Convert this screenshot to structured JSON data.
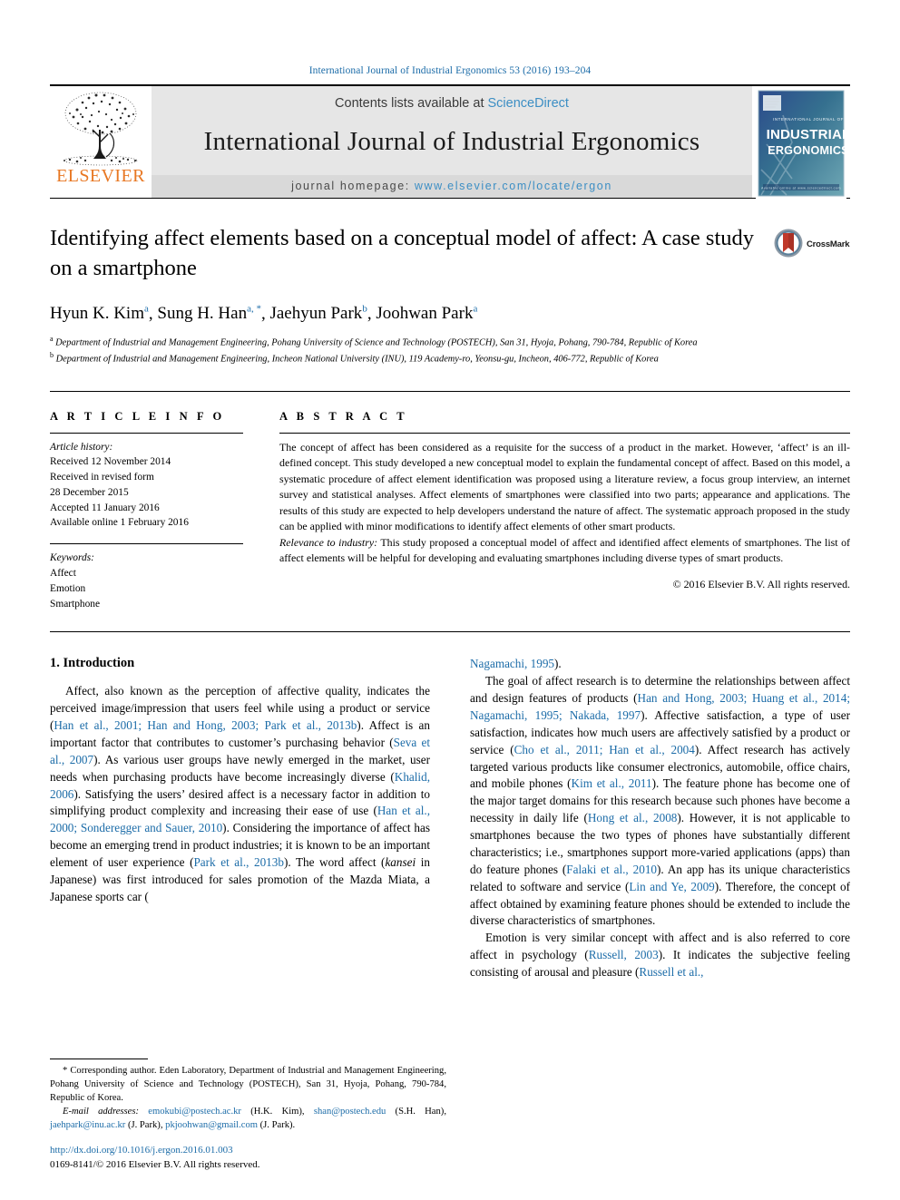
{
  "running_head": "International Journal of Industrial Ergonomics 53 (2016) 193–204",
  "masthead": {
    "contents_prefix": "Contents lists available at ",
    "sciencedirect": "ScienceDirect",
    "journal_name": "International Journal of Industrial Ergonomics",
    "homepage_label": "journal homepage: ",
    "homepage_url": "www.elsevier.com/locate/ergon",
    "publisher": "ELSEVIER",
    "cover_line1": "INTERNATIONAL JOURNAL OF",
    "cover_line2": "INDUSTRIAL",
    "cover_line3": "ERGONOMICS",
    "accent_blue": "#3c8ec4",
    "elsevier_orange": "#e87722"
  },
  "article": {
    "title": "Identifying affect elements based on a conceptual model of affect: A case study on a smartphone",
    "crossmark_label": "CrossMark",
    "authors": [
      {
        "name": "Hyun K. Kim",
        "sup": "a"
      },
      {
        "name": "Sung H. Han",
        "sup": "a, *"
      },
      {
        "name": "Jaehyun Park",
        "sup": "b"
      },
      {
        "name": "Joohwan Park",
        "sup": "a"
      }
    ],
    "affiliations": [
      {
        "mark": "a",
        "text": "Department of Industrial and Management Engineering, Pohang University of Science and Technology (POSTECH), San 31, Hyoja, Pohang, 790-784, Republic of Korea"
      },
      {
        "mark": "b",
        "text": "Department of Industrial and Management Engineering, Incheon National University (INU), 119 Academy-ro, Yeonsu-gu, Incheon, 406-772, Republic of Korea"
      }
    ]
  },
  "article_info": {
    "heading": "A R T I C L E  I N F O",
    "history_label": "Article history:",
    "history": [
      "Received 12 November 2014",
      "Received in revised form",
      "28 December 2015",
      "Accepted 11 January 2016",
      "Available online 1 February 2016"
    ],
    "keywords_label": "Keywords:",
    "keywords": [
      "Affect",
      "Emotion",
      "Smartphone"
    ]
  },
  "abstract": {
    "heading": "A B S T R A C T",
    "text": "The concept of affect has been considered as a requisite for the success of a product in the market. However, ‘affect’ is an ill-defined concept. This study developed a new conceptual model to explain the fundamental concept of affect. Based on this model, a systematic procedure of affect element identification was proposed using a literature review, a focus group interview, an internet survey and statistical analyses. Affect elements of smartphones were classified into two parts; appearance and applications. The results of this study are expected to help developers understand the nature of affect. The systematic approach proposed in the study can be applied with minor modifications to identify affect elements of other smart products.",
    "relevance_label": "Relevance to industry:",
    "relevance_text": " This study proposed a conceptual model of affect and identified affect elements of smartphones. The list of affect elements will be helpful for developing and evaluating smartphones including diverse types of smart products.",
    "copyright": "© 2016 Elsevier B.V. All rights reserved."
  },
  "introduction": {
    "heading": "1. Introduction",
    "left_paragraph_1_a": "Affect, also known as the perception of affective quality, indicates the perceived image/impression that users feel while using a product or service (",
    "left_cite_1": "Han et al., 2001; Han and Hong, 2003; Park et al., 2013b",
    "left_paragraph_1_b": "). Affect is an important factor that contributes to customer’s purchasing behavior (",
    "left_cite_2": "Seva et al., 2007",
    "left_paragraph_1_c": "). As various user groups have newly emerged in the market, user needs when purchasing products have become increasingly diverse (",
    "left_cite_3": "Khalid, 2006",
    "left_paragraph_1_d": "). Satisfying the users’ desired affect is a necessary factor in addition to simplifying product complexity and increasing their ease of use (",
    "left_cite_4": "Han et al., 2000; Sonderegger and Sauer, 2010",
    "left_paragraph_1_e": "). Considering the importance of affect has become an emerging trend in product industries; it is known to be an important element of user experience (",
    "left_cite_5": "Park et al., 2013b",
    "left_paragraph_1_f": "). The word affect (",
    "kansei": "kansei",
    "left_paragraph_1_g": " in Japanese) was first introduced for sales promotion of the Mazda Miata, a Japanese sports car (",
    "right_cite_1": "Nagamachi, 1995",
    "right_paragraph_1_end": ").",
    "right_paragraph_2_a": "The goal of affect research is to determine the relationships between affect and design features of products (",
    "right_cite_2": "Han and Hong, 2003; Huang et al., 2014; Nagamachi, 1995; Nakada, 1997",
    "right_paragraph_2_b": "). Affective satisfaction, a type of user satisfaction, indicates how much users are affectively satisfied by a product or service (",
    "right_cite_3": "Cho et al., 2011; Han et al., 2004",
    "right_paragraph_2_c": "). Affect research has actively targeted various products like consumer electronics, automobile, office chairs, and mobile phones (",
    "right_cite_4": "Kim et al., 2011",
    "right_paragraph_2_d": "). The feature phone has become one of the major target domains for this research because such phones have become a necessity in daily life (",
    "right_cite_5": "Hong et al., 2008",
    "right_paragraph_2_e": "). However, it is not applicable to smartphones because the two types of phones have substantially different characteristics; i.e., smartphones support more-varied applications (apps) than do feature phones (",
    "right_cite_6": "Falaki et al., 2010",
    "right_paragraph_2_f": "). An app has its unique characteristics related to software and service (",
    "right_cite_7": "Lin and Ye, 2009",
    "right_paragraph_2_g": "). Therefore, the concept of affect obtained by examining feature phones should be extended to include the diverse characteristics of smartphones.",
    "right_paragraph_3_a": "Emotion is very similar concept with affect and is also referred to core affect in psychology (",
    "right_cite_8": "Russell, 2003",
    "right_paragraph_3_b": "). It indicates the subjective feeling consisting of arousal and pleasure (",
    "right_cite_9": "Russell et al.,",
    "cite_color": "#1c6ca8"
  },
  "footnote": {
    "corresponding": "* Corresponding author. Eden Laboratory, Department of Industrial and Management Engineering, Pohang University of Science and Technology (POSTECH), San 31, Hyoja, Pohang, 790-784, Republic of Korea.",
    "email_label": "E-mail addresses:",
    "email_1": "emokubi@postech.ac.kr",
    "email_1_owner": " (H.K. Kim), ",
    "email_2": "shan@postech.edu",
    "email_2_owner": " (S.H. Han), ",
    "email_3": "jaehpark@inu.ac.kr",
    "email_3_owner": " (J. Park), ",
    "email_4": "pkjoohwan@gmail.com",
    "email_4_owner": " (J. Park).",
    "doi": "http://dx.doi.org/10.1016/j.ergon.2016.01.003",
    "issn_line": "0169-8141/© 2016 Elsevier B.V. All rights reserved."
  }
}
